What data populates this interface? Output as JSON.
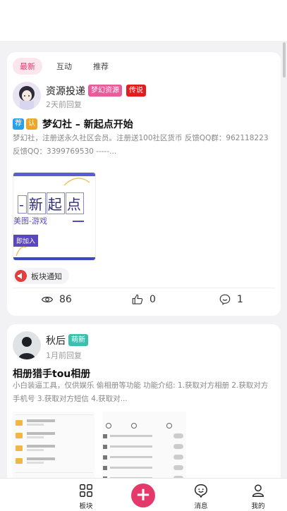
{
  "tabs": [
    {
      "label": "最新"
    },
    {
      "label": "互动"
    },
    {
      "label": "推荐"
    }
  ],
  "post1": {
    "author": "资源投递",
    "badge1": "梦幻资源",
    "badge1_color": "#e85c9c",
    "badge2": "传说",
    "badge2_color": "#e31d1d",
    "time": "2天前回复",
    "tag1": "荐",
    "tag1_color": "#26a0e8",
    "tag2": "认",
    "tag2_color": "#f0a524",
    "title": "梦幻社 – 新起点开始",
    "excerpt": "梦幻社，注册送永久社区会员。注册送100社区货币 反馈QQ群：962118223 反馈QQ：3399769530 -----...",
    "image": {
      "headline_chars": [
        "-",
        "新",
        "起",
        "点"
      ],
      "subline": "美图-游戏",
      "dash": "—",
      "join": "即加入"
    },
    "board": "板块通知",
    "views": "86",
    "likes": "0",
    "comments": "1"
  },
  "post2": {
    "author": "秋后",
    "badge1": "萌新",
    "badge1_color": "#3dbfb0",
    "time": "1月前回复",
    "title": "相册猎手tou相册",
    "excerpt": "小白装逼工具，仅供娱乐 偷相册等功能 功能介绍: 1.获取对方相册 2.获取对方手机号 3.获取对方短信 4.获取对..."
  },
  "nav": {
    "board": "板块",
    "plus": "+",
    "messages": "消息",
    "mine": "我的"
  },
  "colors": {
    "accent": "#e5396b",
    "tab_active_bg": "#fbe6ee"
  }
}
